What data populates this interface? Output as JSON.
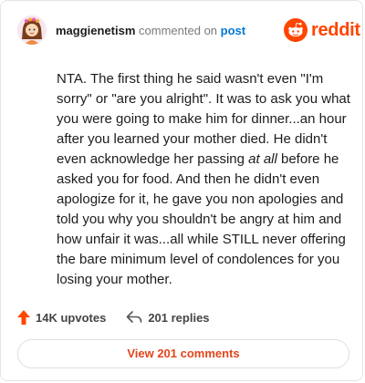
{
  "header": {
    "username": "maggienetism",
    "action_text": "commented on",
    "post_link": "post",
    "logo_text": "reddit"
  },
  "comment": {
    "before_em": "NTA. The first thing he said wasn't even \"I'm sorry\" or \"are you alright\". It was to ask you what you were going to make him for dinner...an hour after you learned your mother died. He didn't even acknowledge her passing ",
    "em": "at all",
    "after_em": " before he asked you for food. And then he didn't even apologize for it, he gave you non apologies and told you why you shouldn't be angry at him and how unfair it was...all while STILL never offering the bare minimum level of condolences for you losing your mother."
  },
  "stats": {
    "upvotes": "14K upvotes",
    "replies": "201 replies"
  },
  "view_button": "View 201 comments",
  "colors": {
    "brand": "#ff4500",
    "link": "#0079d3"
  },
  "icons": {
    "avatar": "user-avatar",
    "logo": "reddit-logo-icon",
    "upvote": "upvote-arrow-icon",
    "reply": "reply-arrow-icon"
  }
}
